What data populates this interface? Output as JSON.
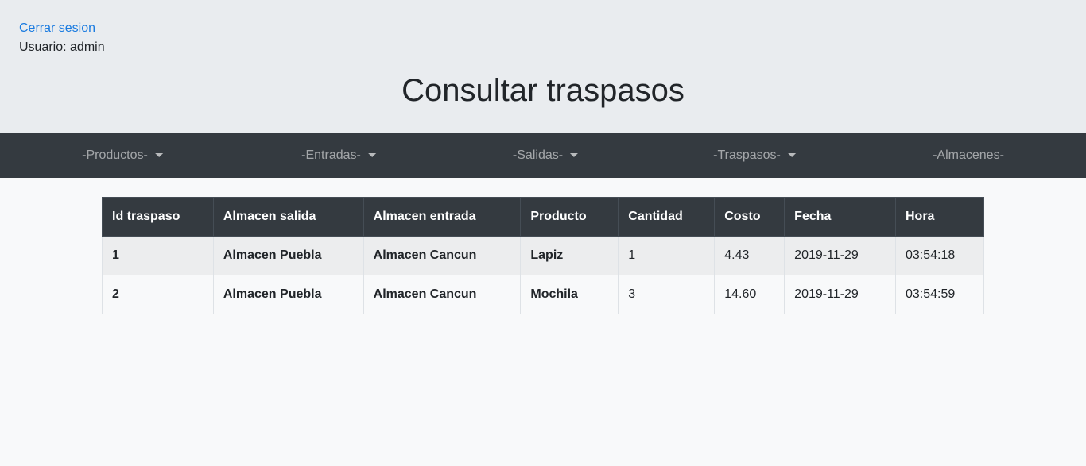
{
  "header": {
    "logout_label": "Cerrar sesion",
    "user_label": "Usuario: admin",
    "title": "Consultar traspasos"
  },
  "nav": {
    "items": [
      {
        "label": "-Productos-",
        "has_dropdown": true
      },
      {
        "label": "-Entradas-",
        "has_dropdown": true
      },
      {
        "label": "-Salidas-",
        "has_dropdown": true
      },
      {
        "label": "-Traspasos-",
        "has_dropdown": true
      },
      {
        "label": "-Almacenes-",
        "has_dropdown": false
      }
    ]
  },
  "table": {
    "headers": [
      "Id traspaso",
      "Almacen salida",
      "Almacen entrada",
      "Producto",
      "Cantidad",
      "Costo",
      "Fecha",
      "Hora"
    ],
    "rows": [
      [
        "1",
        "Almacen Puebla",
        "Almacen Cancun",
        "Lapiz",
        "1",
        "4.43",
        "2019-11-29",
        "03:54:18"
      ],
      [
        "2",
        "Almacen Puebla",
        "Almacen Cancun",
        "Mochila",
        "3",
        "14.60",
        "2019-11-29",
        "03:54:59"
      ]
    ]
  },
  "colors": {
    "header_bg": "#e9ecef",
    "navbar_bg": "#343a40",
    "link": "#1a7be0",
    "table_header_bg": "#343a40"
  }
}
